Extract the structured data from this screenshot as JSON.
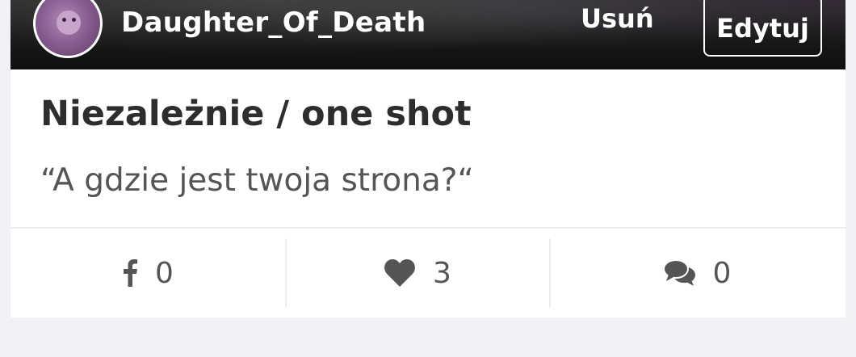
{
  "header": {
    "username": "Daughter_Of_Death",
    "delete_label": "Usuń",
    "edit_label": "Edytuj"
  },
  "post": {
    "title": "Niezależnie / one shot",
    "quote": "“A gdzie jest twoja strona?“"
  },
  "stats": {
    "facebook_count": "0",
    "likes_count": "3",
    "comments_count": "0"
  },
  "icons": [
    "avatar",
    "facebook-icon",
    "heart-icon",
    "comments-icon"
  ],
  "colors": {
    "cover": "#151516",
    "text": "#2d2d2d",
    "muted": "#555555",
    "background": "#f1f2f5"
  }
}
